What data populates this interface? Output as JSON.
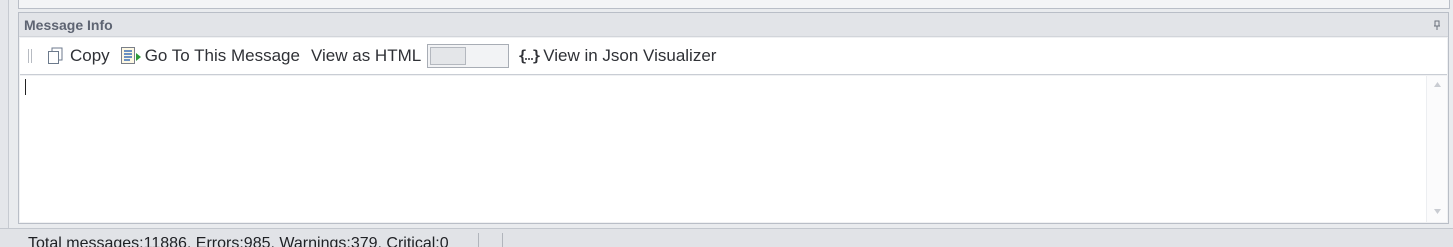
{
  "panel": {
    "title": "Message Info"
  },
  "toolbar": {
    "copy_label": "Copy",
    "goto_label": "Go To This Message",
    "view_html_label": "View as HTML",
    "view_html_toggle": "off",
    "json_label": "View in Json Visualizer"
  },
  "content": {
    "text": ""
  },
  "status": {
    "text": "Total messages:11886, Errors:985, Warnings:379, Critical:0"
  },
  "icons": {
    "pin": "pin-icon",
    "copy": "copy-icon",
    "goto": "go-to-message-icon",
    "json": "json-braces-icon"
  },
  "colors": {
    "panel_caption_text": "#5e6472",
    "panel_border": "#b9bec7",
    "background": "#e9ebee"
  }
}
